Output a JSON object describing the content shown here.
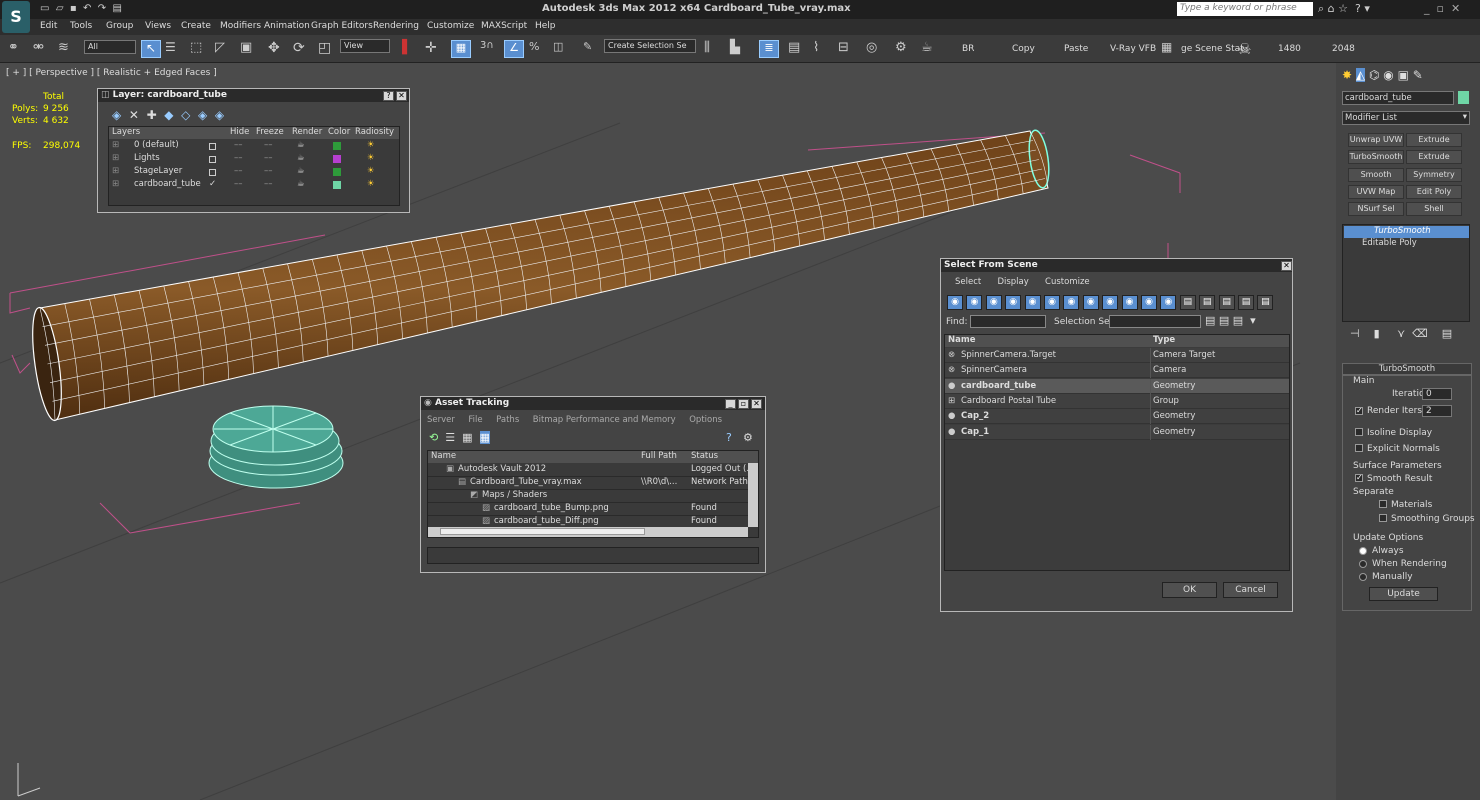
{
  "app": {
    "title": "Autodesk 3ds Max  2012 x64     Cardboard_Tube_vray.max",
    "search_placeholder": "Type a keyword or phrase"
  },
  "menu": [
    "Edit",
    "Tools",
    "Group",
    "Views",
    "Create",
    "Modifiers",
    "Animation",
    "Graph Editors",
    "Rendering",
    "Customize",
    "MAXScript",
    "Help"
  ],
  "toolbar": {
    "filter": "All",
    "ref_coord": "View",
    "sel_set": "Create Selection Se",
    "br": "BR",
    "copy": "Copy",
    "paste": "Paste",
    "vray": "V-Ray VFB",
    "scene": "ge Scene Stat",
    "w": "1480",
    "h": "2048"
  },
  "viewport": {
    "label": "[ + ] [ Perspective ] [ Realistic + Edged Faces ]",
    "stats": {
      "total": "Total",
      "polys_label": "Polys:",
      "polys": "9 256",
      "verts_label": "Verts:",
      "verts": "4 632",
      "fps_label": "FPS:",
      "fps": "298,074"
    }
  },
  "layer_window": {
    "title": "Layer: cardboard_tube",
    "headers": [
      "Layers",
      "Hide",
      "Freeze",
      "Render",
      "Color",
      "Radiosity"
    ],
    "rows": [
      {
        "name": "0 (default)",
        "color": "#2e9b3a"
      },
      {
        "name": "Lights",
        "color": "#b63fcf"
      },
      {
        "name": "StageLayer",
        "color": "#2e9b3a"
      },
      {
        "name": "cardboard_tube",
        "color": "#6fd6a6"
      }
    ]
  },
  "asset_window": {
    "title": "Asset Tracking",
    "menu": [
      "Server",
      "File",
      "Paths",
      "Bitmap Performance and Memory",
      "Options"
    ],
    "headers": [
      "Name",
      "Full Path",
      "Status"
    ],
    "rows": [
      {
        "name": "Autodesk Vault 2012",
        "path": "",
        "status": "Logged Out (..."
      },
      {
        "name": "Cardboard_Tube_vray.max",
        "path": "\\\\R0\\d\\...",
        "status": "Network Path"
      },
      {
        "name": "Maps / Shaders",
        "path": "",
        "status": ""
      },
      {
        "name": "cardboard_tube_Bump.png",
        "path": "",
        "status": "Found"
      },
      {
        "name": "cardboard_tube_Diff.png",
        "path": "",
        "status": "Found"
      }
    ]
  },
  "select_window": {
    "title": "Select From Scene",
    "menu": [
      "Select",
      "Display",
      "Customize"
    ],
    "find_label": "Find:",
    "set_label": "Selection Set:",
    "headers": [
      "Name",
      "Type"
    ],
    "rows": [
      {
        "name": "SpinnerCamera.Target",
        "type": "Camera Target"
      },
      {
        "name": "SpinnerCamera",
        "type": "Camera"
      },
      {
        "name": "cardboard_tube",
        "type": "Geometry"
      },
      {
        "name": "Cardboard Postal Tube",
        "type": "Group"
      },
      {
        "name": "Cap_2",
        "type": "Geometry"
      },
      {
        "name": "Cap_1",
        "type": "Geometry"
      }
    ],
    "ok": "OK",
    "cancel": "Cancel"
  },
  "command_panel": {
    "object_name": "cardboard_tube",
    "modifier_list": "Modifier List",
    "buttons": [
      "Unwrap UVW",
      "Extrude",
      "TurboSmooth",
      "Extrude",
      "Smooth",
      "Symmetry",
      "UVW Map",
      "Edit Poly",
      "NSurf Sel",
      "Shell"
    ],
    "stack": [
      "TurboSmooth",
      "Editable Poly"
    ],
    "rollout": "TurboSmooth",
    "main": "Main",
    "iterations_label": "Iterations:",
    "iterations": "0",
    "render_iters_label": "Render Iters:",
    "render_iters": "2",
    "isoline": "Isoline Display",
    "explicit": "Explicit Normals",
    "surface": "Surface Parameters",
    "smooth_result": "Smooth Result",
    "separate": "Separate",
    "materials": "Materials",
    "smoothing_groups": "Smoothing Groups",
    "update_options": "Update Options",
    "always": "Always",
    "when_rendering": "When Rendering",
    "manually": "Manually",
    "update": "Update"
  }
}
